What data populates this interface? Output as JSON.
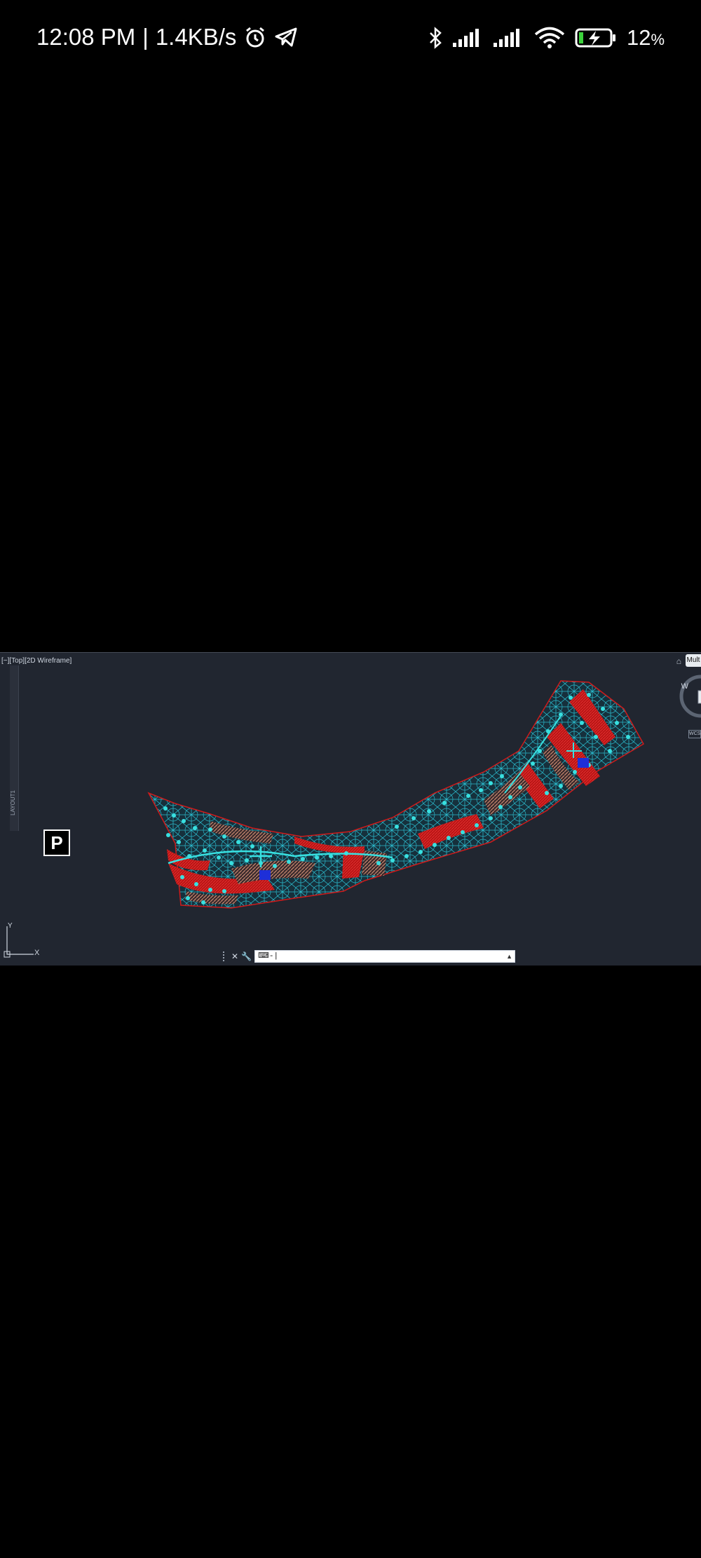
{
  "status_bar": {
    "time": "12:08 PM",
    "separator": "|",
    "network_speed": "1.4KB/s",
    "battery_percent": "12",
    "battery_unit": "%",
    "icons": [
      "alarm-icon",
      "telegram-icon",
      "bluetooth-icon",
      "signal-icon",
      "signal-icon",
      "wifi-icon",
      "battery-charging-icon"
    ]
  },
  "cad": {
    "viewport_label": "[−][Top][2D Wireframe]",
    "tooltip": "Mult",
    "viewcube_label": "W",
    "wcs_label": "WCS",
    "side_panel_label": "LAYOUT1",
    "p_badge": "P",
    "command_prompt": "⌨-|",
    "ucs_x": "X",
    "ucs_y": "Y",
    "colors": {
      "background": "#212630",
      "hatch_red": "#d01a1a",
      "points_cyan": "#38e0e0",
      "hatch_tan": "#c98b72",
      "blue_block": "#1e2fd8"
    }
  }
}
